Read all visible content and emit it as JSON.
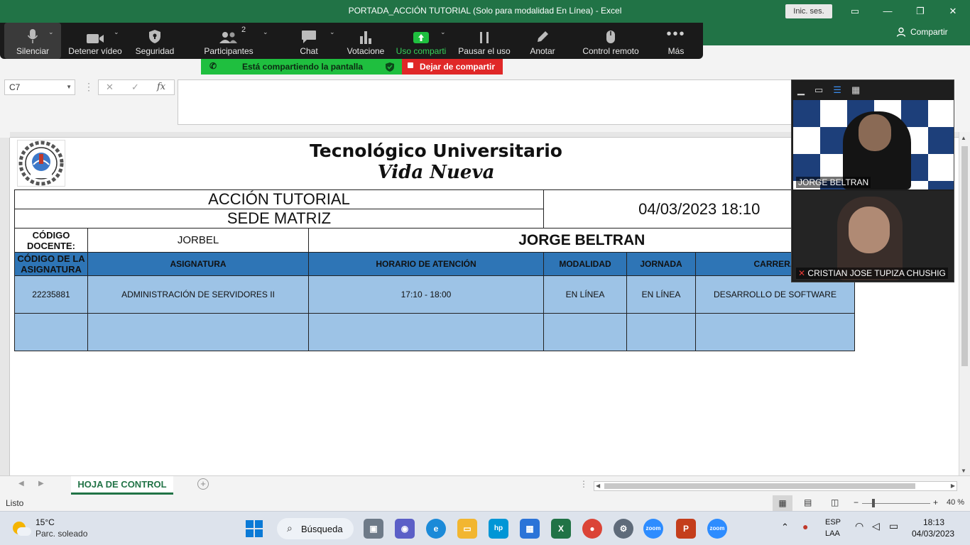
{
  "excel": {
    "title": "PORTADA_ACCIÓN TUTORIAL (Solo para modalidad En Línea)  -  Excel",
    "sign_in": "Inic. ses.",
    "share": "Compartir",
    "name_box": "C7",
    "fx_label": "fx",
    "status": "Listo",
    "zoom_level": "40 %",
    "sheet_tab": "HOJA DE CONTROL"
  },
  "zoom": {
    "toolbar": [
      {
        "label": "Silenciar",
        "icon": "microphone-icon"
      },
      {
        "label": "Detener vídeo",
        "icon": "video-camera-icon"
      },
      {
        "label": "Seguridad",
        "icon": "shield-icon"
      },
      {
        "label": "Participantes",
        "icon": "participants-icon",
        "count": "2"
      },
      {
        "label": "Chat",
        "icon": "chat-icon"
      },
      {
        "label": "Votacione",
        "icon": "poll-icon"
      },
      {
        "label": "Uso comparti",
        "icon": "share-screen-icon"
      },
      {
        "label": "Pausar el uso",
        "icon": "pause-icon"
      },
      {
        "label": "Anotar",
        "icon": "pen-icon"
      },
      {
        "label": "Control remoto",
        "icon": "mouse-icon"
      },
      {
        "label": "Más",
        "icon": "more-icon"
      }
    ],
    "sharing_text": "Está compartiendo la pantalla",
    "stop_sharing": "Dejar de compartir",
    "participants": [
      {
        "name": "JORGE BELTRAN"
      },
      {
        "name": "CRISTIAN JOSE TUPIZA CHUSHIG"
      }
    ]
  },
  "sheet": {
    "institution_line1": "Tecnológico Universitario",
    "institution_line2": "Vida Nueva",
    "section_title": "ACCIÓN TUTORIAL",
    "campus": "SEDE MATRIZ",
    "datetime": "04/03/2023 18:10",
    "teacher_code_label": "CÓDIGO DOCENTE:",
    "teacher_code": "JORBEL",
    "teacher_name": "JORGE BELTRAN",
    "headers": [
      "CÓDIGO DE LA ASIGNATURA",
      "ASIGNATURA",
      "HORARIO DE ATENCIÓN",
      "MODALIDAD",
      "JORNADA",
      "CARRERA"
    ],
    "row": [
      "22235881",
      "ADMINISTRACIÓN DE SERVIDORES II",
      "17:10 - 18:00",
      "EN LÍNEA",
      "EN LÍNEA",
      "DESARROLLO DE SOFTWARE"
    ]
  },
  "taskbar": {
    "weather_temp": "15°C",
    "weather_desc": "Parc. soleado",
    "search": "Búsqueda",
    "lang1": "ESP",
    "lang2": "LAA",
    "time": "18:13",
    "date": "04/03/2023"
  },
  "colors": {
    "excel_green": "#217346",
    "header_blue": "#2e75b6",
    "row_blue": "#9dc3e6",
    "share_green": "#1fbf3f",
    "stop_red": "#e02828"
  }
}
